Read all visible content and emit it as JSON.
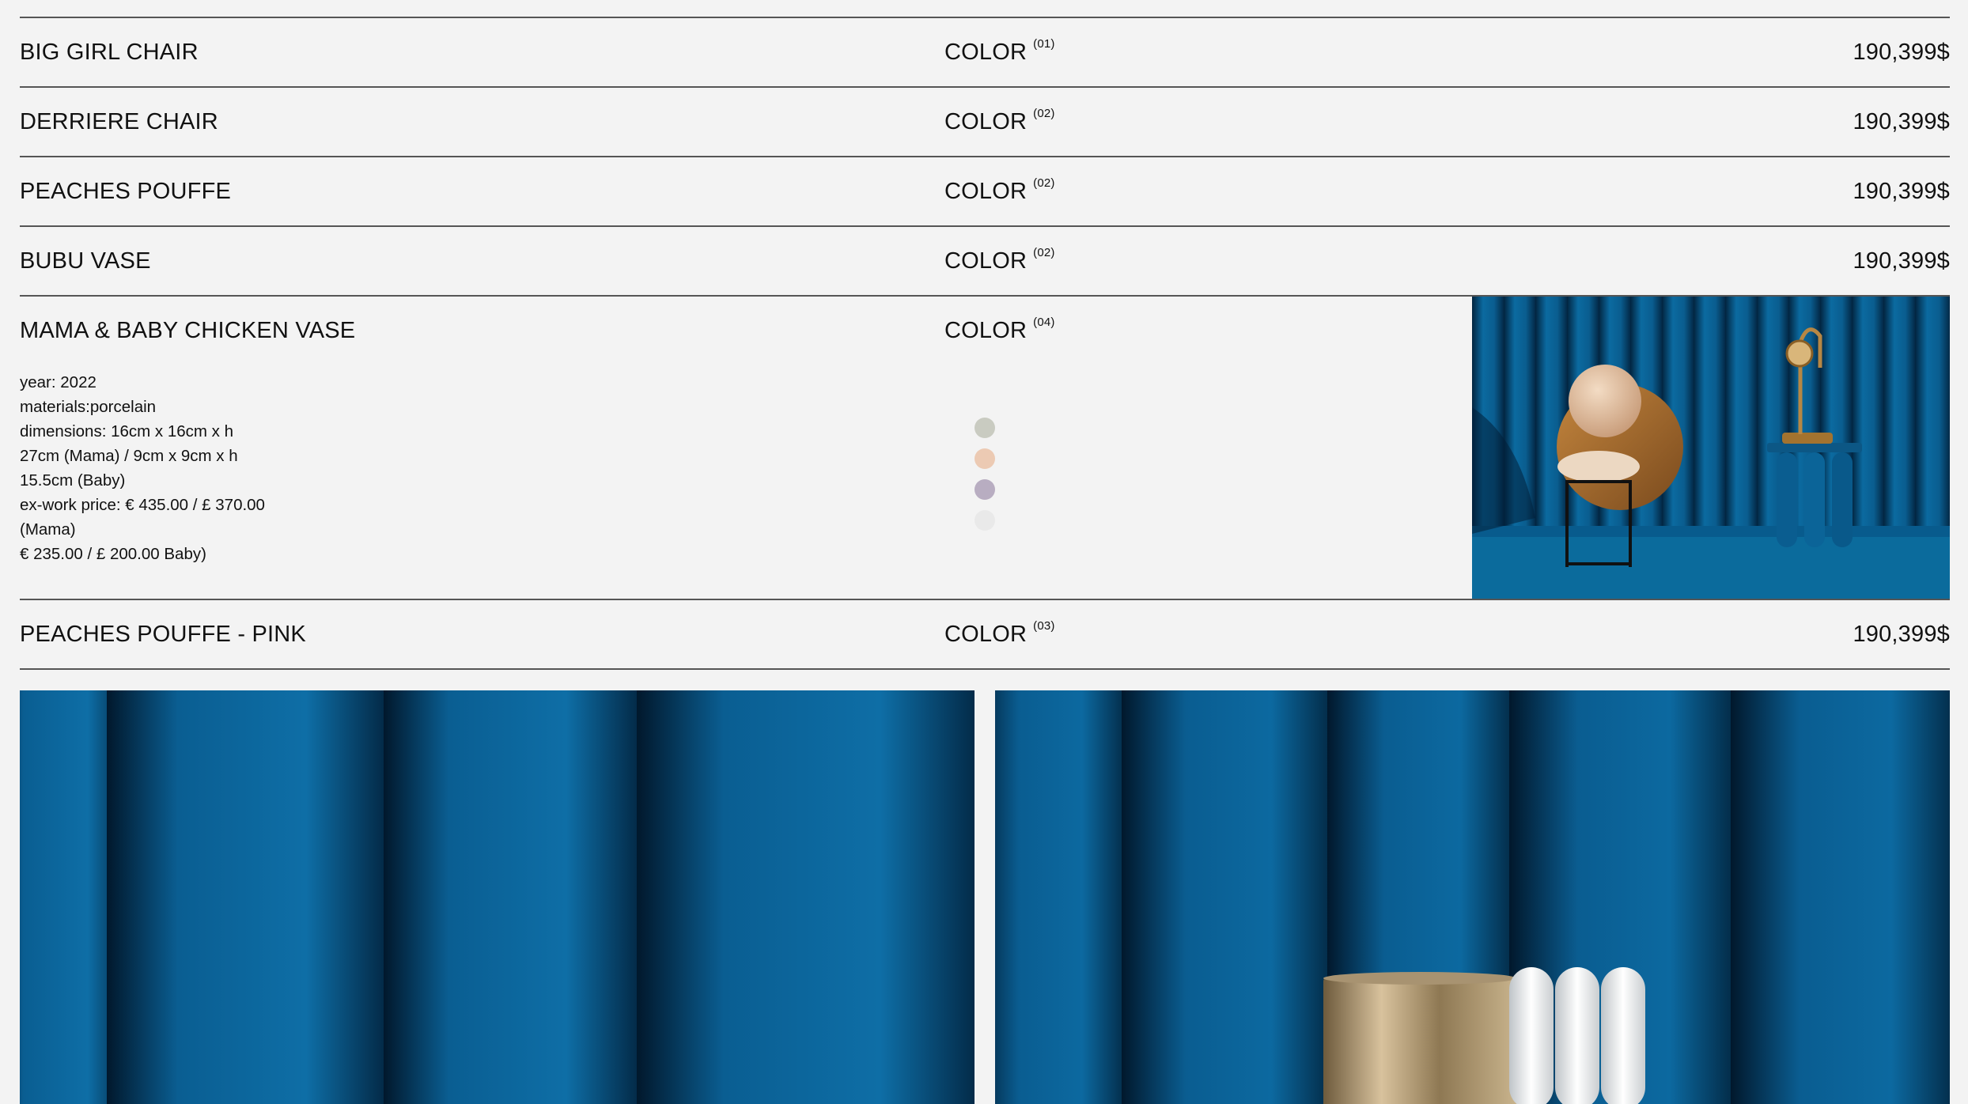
{
  "products": [
    {
      "name": "BIG GIRL CHAIR",
      "color_label": "COLOR",
      "color_count": "(01)",
      "price": "190,399$"
    },
    {
      "name": "DERRIERE CHAIR",
      "color_label": "COLOR",
      "color_count": "(02)",
      "price": "190,399$"
    },
    {
      "name": "PEACHES POUFFE",
      "color_label": "COLOR",
      "color_count": "(02)",
      "price": "190,399$"
    },
    {
      "name": "BUBU VASE",
      "color_label": "COLOR",
      "color_count": "(02)",
      "price": "190,399$"
    }
  ],
  "expanded": {
    "name": "MAMA & BABY CHICKEN VASE",
    "color_label": "COLOR",
    "color_count": "(04)",
    "details": [
      "year: 2022",
      "materials:porcelain",
      "dimensions: 16cm x 16cm x h",
      "27cm (Mama) / 9cm x 9cm x h",
      "15.5cm (Baby)",
      "ex-work price: € 435.00 / £ 370.00",
      "(Mama)",
      "€ 235.00 / £ 200.00 Baby)"
    ],
    "swatches": [
      "#c9cbc1",
      "#eccab3",
      "#b8adc1",
      "#e9e9e9"
    ]
  },
  "last_product": {
    "name": "PEACHES POUFFE - PINK",
    "color_label": "COLOR",
    "color_count": "(03)",
    "price": "190,399$"
  },
  "theme": {
    "background": "#f3f3f3",
    "rule": "#555555",
    "image_blue": "#0a5f92"
  }
}
